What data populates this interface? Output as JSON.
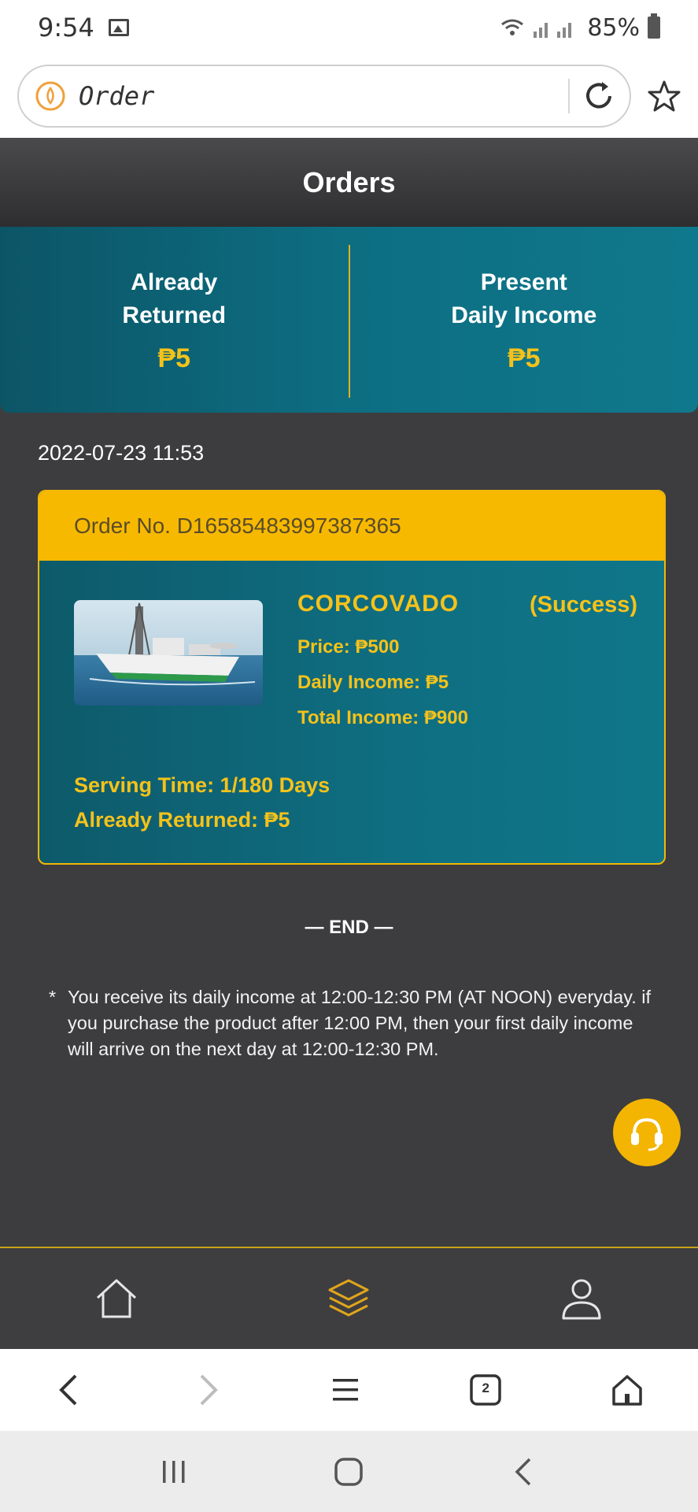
{
  "status_bar": {
    "time": "9:54",
    "battery": "85%"
  },
  "browser": {
    "url_text": "Order"
  },
  "header": {
    "title": "Orders"
  },
  "summary": {
    "already_returned_label_1": "Already",
    "already_returned_label_2": "Returned",
    "already_returned_value": "₱5",
    "present_income_label_1": "Present",
    "present_income_label_2": "Daily Income",
    "present_income_value": "₱5"
  },
  "order": {
    "date": "2022-07-23 11:53",
    "number": "Order No. D16585483997387365",
    "product_name": "CORCOVADO",
    "status": "(Success)",
    "price": "Price: ₱500",
    "daily_income": "Daily Income: ₱5",
    "total_income": "Total Income: ₱900",
    "serving_time": "Serving Time: 1/180 Days",
    "already_returned": "Already Returned: ₱5"
  },
  "end_mark": "— END —",
  "note": {
    "star": "*",
    "text": "You receive its daily income at 12:00-12:30 PM (AT NOON) everyday. if you purchase the product after 12:00 PM, then your first daily income will arrive on the next day at 12:00-12:30 PM."
  },
  "tabs": [
    {
      "icon": "home-icon",
      "active": false
    },
    {
      "icon": "layers-icon",
      "active": true
    },
    {
      "icon": "user-icon",
      "active": false
    }
  ],
  "browser_nav": {
    "tab_count": "2"
  },
  "colors": {
    "accent": "#f5c21a",
    "teal": "#0d6e82",
    "background": "#3d3d3f"
  }
}
